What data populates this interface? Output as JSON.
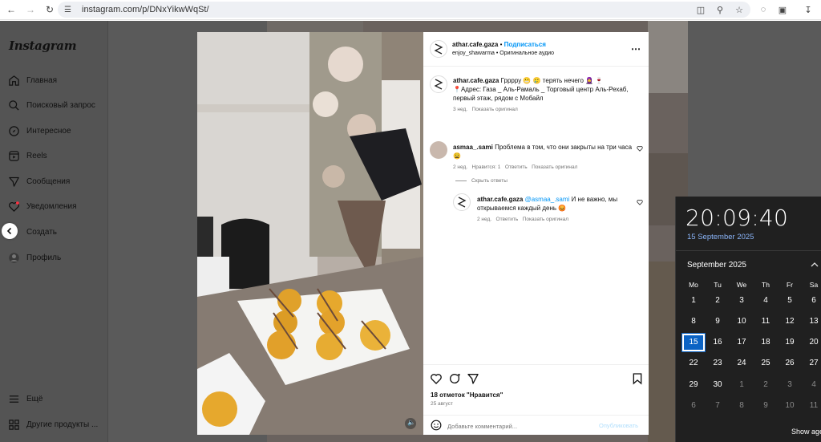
{
  "browser": {
    "url": "instagram.com/p/DNxYikwWqSt/"
  },
  "sidebar": {
    "logo": "Instagram",
    "items": [
      {
        "label": "Главная",
        "icon": "home-icon"
      },
      {
        "label": "Поисковый запрос",
        "icon": "search-icon"
      },
      {
        "label": "Интересное",
        "icon": "explore-icon"
      },
      {
        "label": "Reels",
        "icon": "reels-icon"
      },
      {
        "label": "Сообщения",
        "icon": "messages-icon"
      },
      {
        "label": "Уведомления",
        "icon": "heart-icon"
      },
      {
        "label": "Создать",
        "icon": "create-icon"
      },
      {
        "label": "Профиль",
        "icon": "profile-icon"
      }
    ],
    "more": "Ещё",
    "other": "Другие продукты ..."
  },
  "post": {
    "author": "athar.cafe.gaza",
    "dot": "•",
    "follow": "Подписаться",
    "audio": "enjoy_shawarma • Оригинальное аудио",
    "caption_author": "athar.cafe.gaza",
    "caption_line1": "Грррру 😬 🥲 терять нечего 🧕 🍷",
    "caption_line2": "📍Адрес: Газа _ Аль-Рамаль _ Торговый центр Аль-Рехаб, первый этаж, рядом с Мобайл",
    "caption_time": "3 нед.",
    "caption_translate": "Показать оригинал",
    "comments": [
      {
        "author": "asmaa_.sami",
        "text": "Проблема в том, что они закрыты на три часа 😩",
        "time": "2 нед.",
        "likes": "Нравится: 1",
        "reply": "Ответить",
        "translate": "Показать оригинал"
      }
    ],
    "hide_replies": "Скрыть ответы",
    "reply": {
      "author": "athar.cafe.gaza",
      "mention": "@asmaa_.sami",
      "text": "И не важно, мы открываемся каждый день 😡",
      "time": "2 нед.",
      "reply_label": "Ответить",
      "translate": "Показать оригинал"
    },
    "likes": "18 отметок \"Нравится\"",
    "date": "25 август",
    "add_comment_placeholder": "Добавьте комментарий...",
    "publish": "Опубликовать"
  },
  "clock": {
    "time": "20:09:40",
    "date": "15 September 2025",
    "month": "September 2025",
    "weekdays": [
      "Mo",
      "Tu",
      "We",
      "Th",
      "Fr",
      "Sa"
    ],
    "rows": [
      [
        "1",
        "2",
        "3",
        "4",
        "5",
        "6"
      ],
      [
        "8",
        "9",
        "10",
        "11",
        "12",
        "13"
      ],
      [
        "15",
        "16",
        "17",
        "18",
        "19",
        "20"
      ],
      [
        "22",
        "23",
        "24",
        "25",
        "26",
        "27"
      ],
      [
        "29",
        "30",
        "1",
        "2",
        "3",
        "4"
      ],
      [
        "6",
        "7",
        "8",
        "9",
        "10",
        "11"
      ]
    ],
    "today": "15",
    "show_agenda": "Show agenda"
  },
  "colors": {
    "accent": "#0095f6",
    "today": "#0b63c4",
    "flyout_bg": "#202020"
  }
}
